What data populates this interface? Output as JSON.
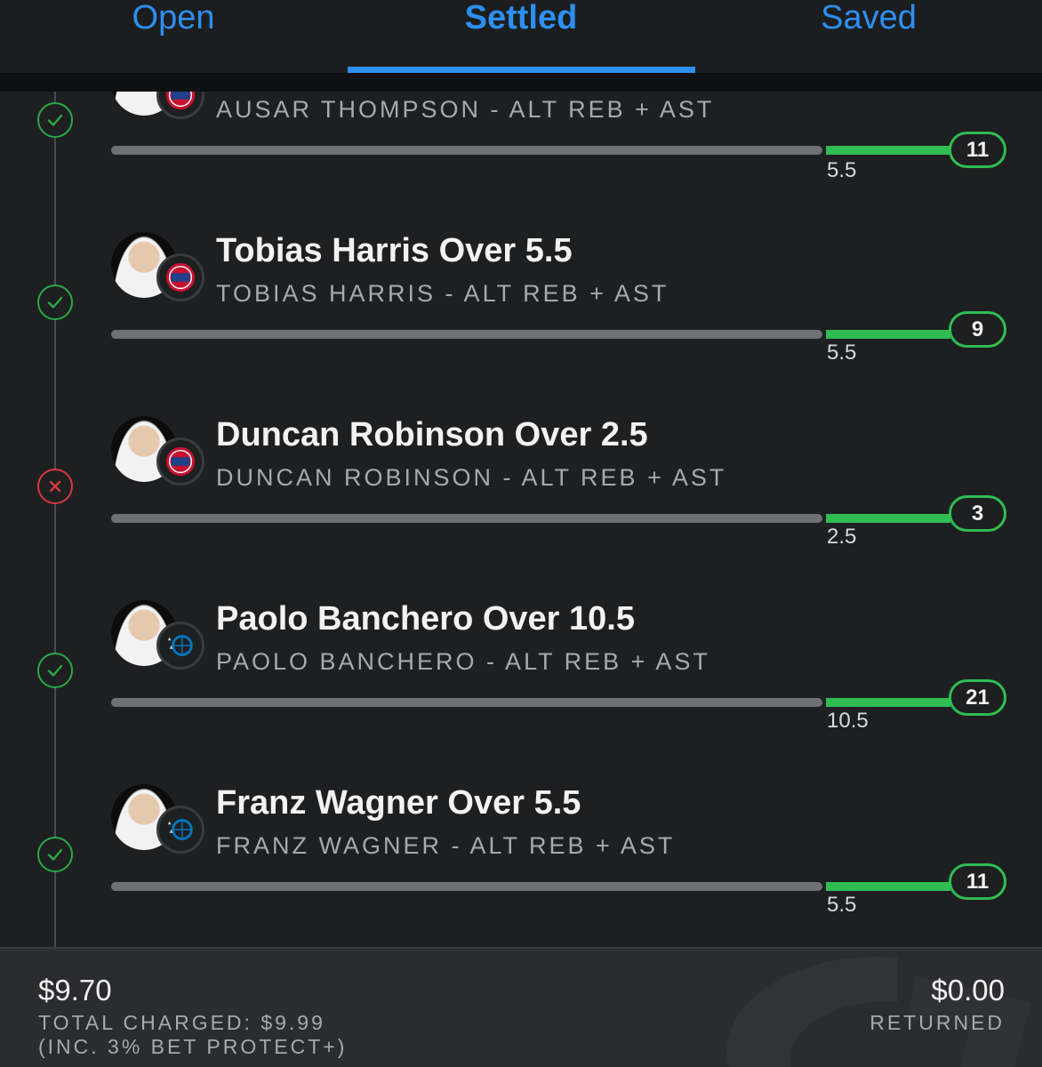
{
  "tabs": [
    {
      "label": "Open"
    },
    {
      "label": "Settled"
    },
    {
      "label": "Saved"
    }
  ],
  "active_tab": "Settled",
  "colors": {
    "accent": "#2d8ff0",
    "win": "#2aa946",
    "loss": "#d63a3f",
    "progress": "#2fbd52"
  },
  "legs": [
    {
      "title": "",
      "subtitle": "AUSAR THOMPSON - ALT REB + AST",
      "line": "5.5",
      "result": "11",
      "status": "win",
      "status_icon": "check-circle-icon",
      "team_icon": "pistons-logo-icon"
    },
    {
      "title": "Tobias Harris Over 5.5",
      "subtitle": "TOBIAS HARRIS - ALT REB + AST",
      "line": "5.5",
      "result": "9",
      "status": "win",
      "status_icon": "check-circle-icon",
      "team_icon": "pistons-logo-icon"
    },
    {
      "title": "Duncan Robinson Over 2.5",
      "subtitle": "DUNCAN ROBINSON - ALT REB + AST",
      "line": "2.5",
      "result": "3",
      "status": "loss",
      "status_icon": "x-circle-icon",
      "team_icon": "pistons-logo-icon"
    },
    {
      "title": "Paolo Banchero Over 10.5",
      "subtitle": "PAOLO BANCHERO - ALT REB + AST",
      "line": "10.5",
      "result": "21",
      "status": "win",
      "status_icon": "check-circle-icon",
      "team_icon": "magic-logo-icon"
    },
    {
      "title": "Franz Wagner Over 5.5",
      "subtitle": "FRANZ WAGNER - ALT REB + AST",
      "line": "5.5",
      "result": "11",
      "status": "win",
      "status_icon": "check-circle-icon",
      "team_icon": "magic-logo-icon"
    }
  ],
  "footer": {
    "stake": "$9.70",
    "total_charged": "TOTAL CHARGED: $9.99",
    "bet_protect": "(INC. 3% BET PROTECT+)",
    "returned_amount": "$0.00",
    "returned_label": "RETURNED"
  }
}
